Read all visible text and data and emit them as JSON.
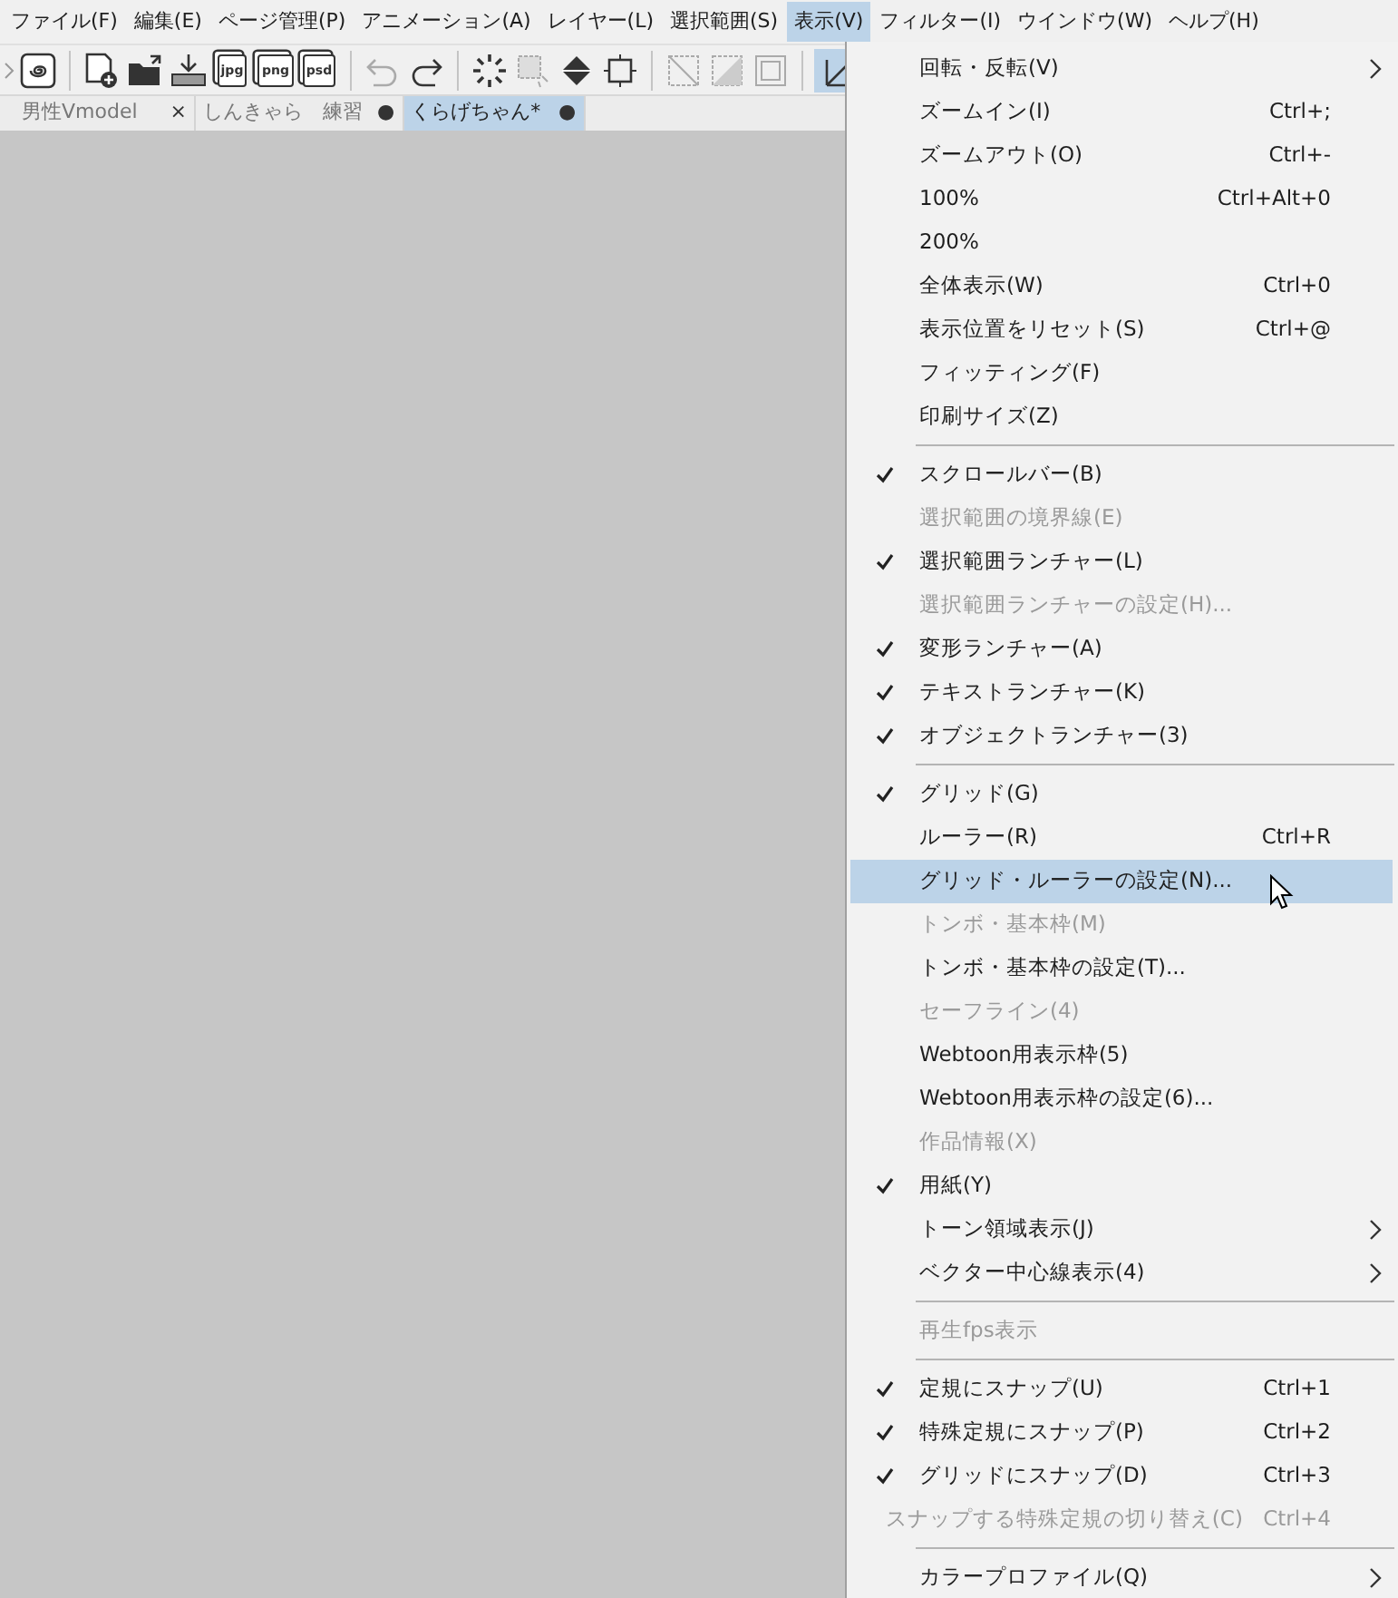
{
  "menu_bar": [
    {
      "label": "ファイル(F)",
      "selected": false
    },
    {
      "label": "編集(E)",
      "selected": false
    },
    {
      "label": "ページ管理(P)",
      "selected": false
    },
    {
      "label": "アニメーション(A)",
      "selected": false
    },
    {
      "label": "レイヤー(L)",
      "selected": false
    },
    {
      "label": "選択範囲(S)",
      "selected": false
    },
    {
      "label": "表示(V)",
      "selected": true
    },
    {
      "label": "フィルター(I)",
      "selected": false
    },
    {
      "label": "ウインドウ(W)",
      "selected": false
    },
    {
      "label": "ヘルプ(H)",
      "selected": false
    }
  ],
  "toolbar": [
    {
      "kind": "logo",
      "disabled": false
    },
    {
      "kind": "separator"
    },
    {
      "kind": "new",
      "disabled": false
    },
    {
      "kind": "open",
      "disabled": false
    },
    {
      "kind": "import",
      "disabled": false
    },
    {
      "kind": "export",
      "label": "jpg",
      "disabled": false
    },
    {
      "kind": "export",
      "label": "png",
      "disabled": false
    },
    {
      "kind": "export",
      "label": "psd",
      "disabled": false
    },
    {
      "kind": "separator"
    },
    {
      "kind": "undo",
      "disabled": true
    },
    {
      "kind": "redo",
      "disabled": false
    },
    {
      "kind": "separator"
    },
    {
      "kind": "select-all",
      "disabled": false
    },
    {
      "kind": "deselect",
      "disabled": true
    },
    {
      "kind": "fill",
      "disabled": false
    },
    {
      "kind": "transform",
      "disabled": false
    },
    {
      "kind": "separator"
    },
    {
      "kind": "clear",
      "disabled": true
    },
    {
      "kind": "clear-outside",
      "disabled": true
    },
    {
      "kind": "frame",
      "disabled": true
    },
    {
      "kind": "separator"
    },
    {
      "kind": "ruler",
      "disabled": false,
      "selected": true
    }
  ],
  "tabs": [
    {
      "label": "男性Vmodel",
      "close": "×",
      "selected": false
    },
    {
      "label": "しんきゃら　練習",
      "close": "●",
      "selected": false
    },
    {
      "label": "くらげちゃん*",
      "close": "●",
      "selected": true
    }
  ],
  "menu": [
    {
      "kind": "item",
      "label": "回転・反転(V)",
      "submenu": true,
      "checked": false,
      "disabled": false,
      "selected": false
    },
    {
      "kind": "item",
      "label": "ズームイン(I)",
      "shortcut": "Ctrl+;",
      "checked": false,
      "disabled": false,
      "selected": false
    },
    {
      "kind": "item",
      "label": "ズームアウト(O)",
      "shortcut": "Ctrl+-",
      "checked": false,
      "disabled": false,
      "selected": false
    },
    {
      "kind": "item",
      "label": "100%",
      "shortcut": "Ctrl+Alt+0",
      "checked": false,
      "disabled": false,
      "selected": false
    },
    {
      "kind": "item",
      "label": "200%",
      "checked": false,
      "disabled": false,
      "selected": false
    },
    {
      "kind": "item",
      "label": "全体表示(W)",
      "shortcut": "Ctrl+0",
      "checked": false,
      "disabled": false,
      "selected": false
    },
    {
      "kind": "item",
      "label": "表示位置をリセット(S)",
      "shortcut": "Ctrl+@",
      "checked": false,
      "disabled": false,
      "selected": false
    },
    {
      "kind": "item",
      "label": "フィッティング(F)",
      "checked": false,
      "disabled": false,
      "selected": false
    },
    {
      "kind": "item",
      "label": "印刷サイズ(Z)",
      "checked": false,
      "disabled": false,
      "selected": false
    },
    {
      "kind": "separator"
    },
    {
      "kind": "item",
      "label": "スクロールバー(B)",
      "checked": true,
      "disabled": false,
      "selected": false
    },
    {
      "kind": "item",
      "label": "選択範囲の境界線(E)",
      "checked": false,
      "disabled": true,
      "selected": false
    },
    {
      "kind": "item",
      "label": "選択範囲ランチャー(L)",
      "checked": true,
      "disabled": false,
      "selected": false
    },
    {
      "kind": "item",
      "label": "選択範囲ランチャーの設定(H)...",
      "checked": false,
      "disabled": true,
      "selected": false
    },
    {
      "kind": "item",
      "label": "変形ランチャー(A)",
      "checked": true,
      "disabled": false,
      "selected": false
    },
    {
      "kind": "item",
      "label": "テキストランチャー(K)",
      "checked": true,
      "disabled": false,
      "selected": false
    },
    {
      "kind": "item",
      "label": "オブジェクトランチャー(3)",
      "checked": true,
      "disabled": false,
      "selected": false
    },
    {
      "kind": "separator"
    },
    {
      "kind": "item",
      "label": "グリッド(G)",
      "checked": true,
      "disabled": false,
      "selected": false
    },
    {
      "kind": "item",
      "label": "ルーラー(R)",
      "shortcut": "Ctrl+R",
      "checked": false,
      "disabled": false,
      "selected": false
    },
    {
      "kind": "item",
      "label": "グリッド・ルーラーの設定(N)...",
      "checked": false,
      "disabled": false,
      "selected": true
    },
    {
      "kind": "item",
      "label": "トンボ・基本枠(M)",
      "checked": false,
      "disabled": true,
      "selected": false
    },
    {
      "kind": "item",
      "label": "トンボ・基本枠の設定(T)...",
      "checked": false,
      "disabled": false,
      "selected": false
    },
    {
      "kind": "item",
      "label": "セーフライン(4)",
      "checked": false,
      "disabled": true,
      "selected": false
    },
    {
      "kind": "item",
      "label": "Webtoon用表示枠(5)",
      "checked": false,
      "disabled": false,
      "selected": false
    },
    {
      "kind": "item",
      "label": "Webtoon用表示枠の設定(6)...",
      "checked": false,
      "disabled": false,
      "selected": false
    },
    {
      "kind": "item",
      "label": "作品情報(X)",
      "checked": false,
      "disabled": true,
      "selected": false
    },
    {
      "kind": "item",
      "label": "用紙(Y)",
      "checked": true,
      "disabled": false,
      "selected": false
    },
    {
      "kind": "item",
      "label": "トーン領域表示(J)",
      "submenu": true,
      "checked": false,
      "disabled": false,
      "selected": false
    },
    {
      "kind": "item",
      "label": "ベクター中心線表示(4)",
      "submenu": true,
      "checked": false,
      "disabled": false,
      "selected": false
    },
    {
      "kind": "separator"
    },
    {
      "kind": "item",
      "label": "再生fps表示",
      "checked": false,
      "disabled": true,
      "selected": false
    },
    {
      "kind": "separator"
    },
    {
      "kind": "item",
      "label": "定規にスナップ(U)",
      "shortcut": "Ctrl+1",
      "checked": true,
      "disabled": false,
      "selected": false
    },
    {
      "kind": "item",
      "label": "特殊定規にスナップ(P)",
      "shortcut": "Ctrl+2",
      "checked": true,
      "disabled": false,
      "selected": false
    },
    {
      "kind": "item",
      "label": "グリッドにスナップ(D)",
      "shortcut": "Ctrl+3",
      "checked": true,
      "disabled": false,
      "selected": false
    },
    {
      "kind": "item",
      "label": "スナップする特殊定規の切り替え(C)",
      "shortcut": "Ctrl+4",
      "checked": false,
      "disabled": true,
      "selected": false
    },
    {
      "kind": "separator"
    },
    {
      "kind": "item",
      "label": "カラープロファイル(Q)",
      "submenu": true,
      "checked": false,
      "disabled": false,
      "selected": false
    }
  ]
}
